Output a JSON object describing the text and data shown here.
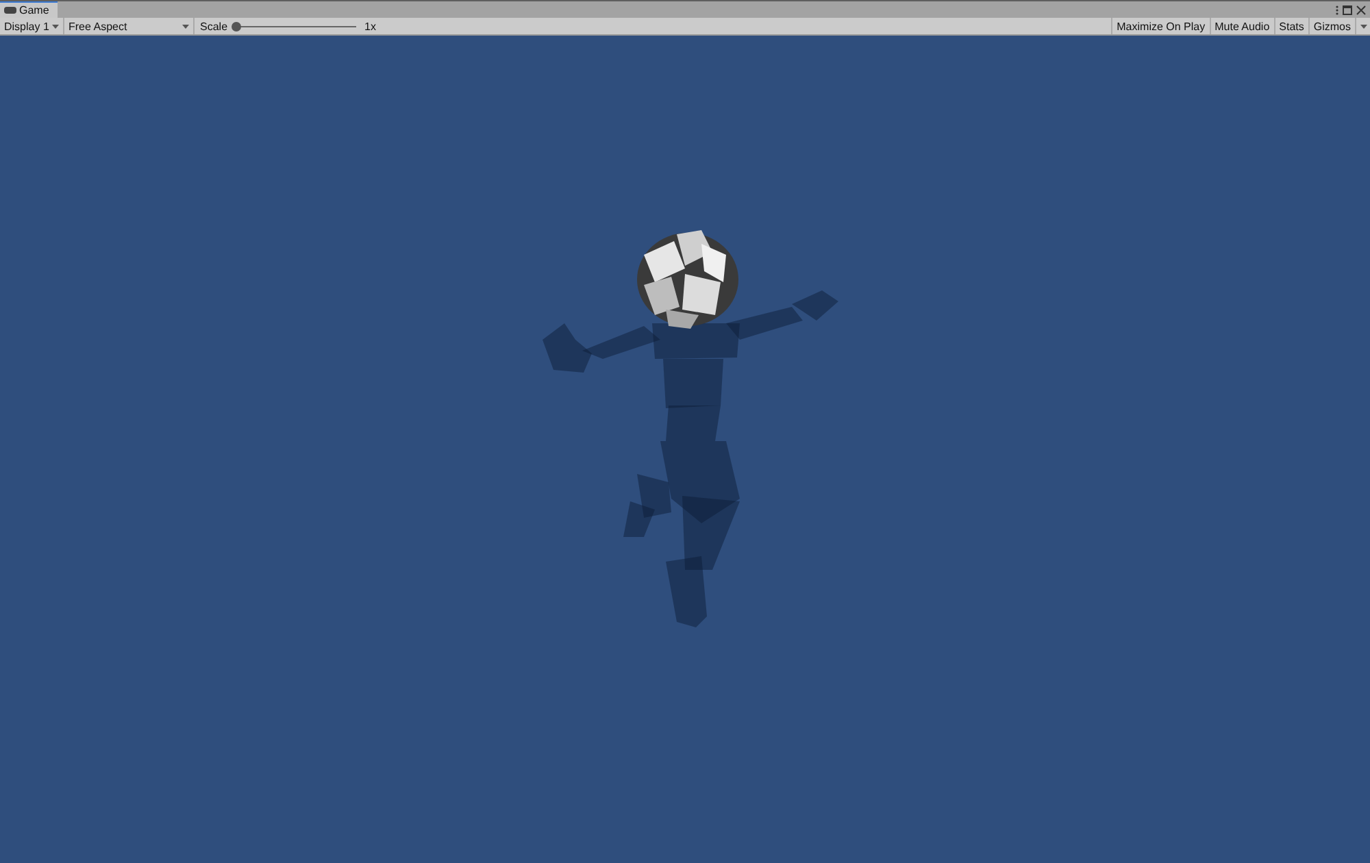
{
  "window": {
    "tabs": [
      {
        "label": "Game",
        "selected": true
      }
    ]
  },
  "toolbar": {
    "display": "Display 1",
    "aspect": "Free Aspect",
    "scale": {
      "label": "Scale",
      "level": 0,
      "reading": "1x"
    },
    "buttons": [
      "Maximize On Play",
      "Mute Audio",
      "Stats",
      "Gizmos"
    ]
  }
}
